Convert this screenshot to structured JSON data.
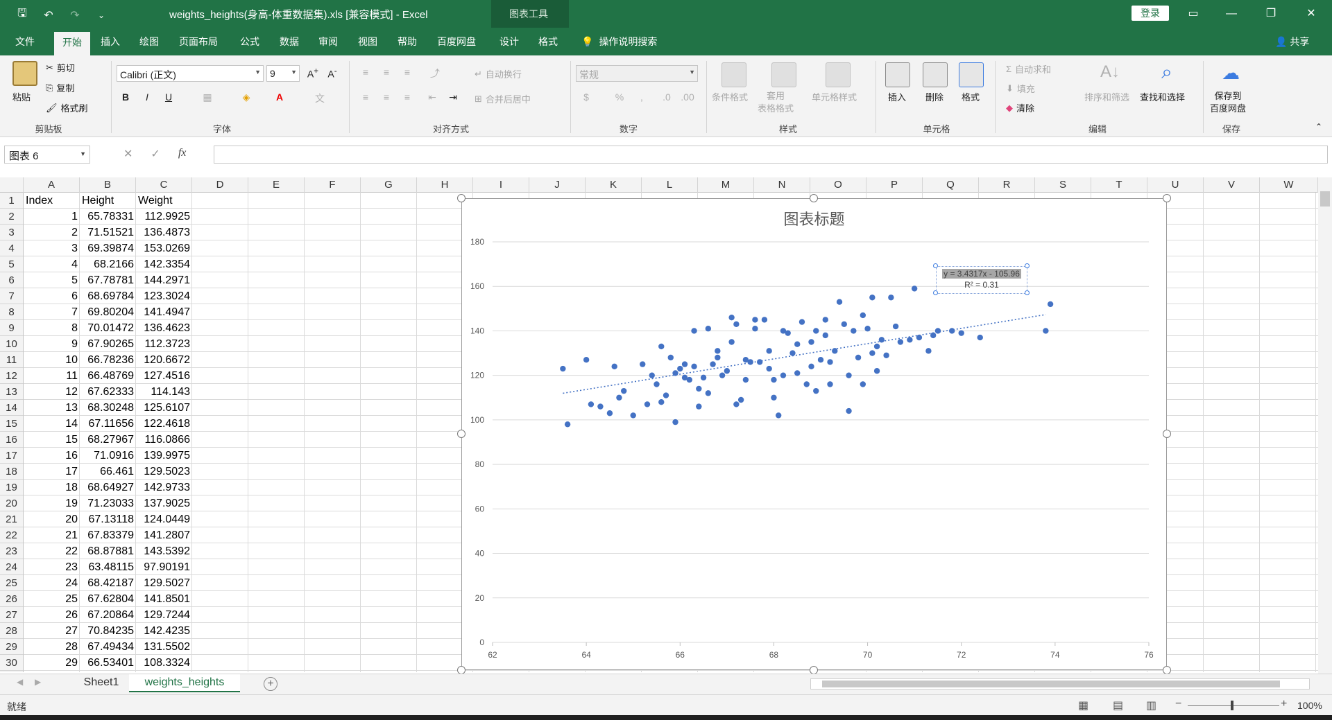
{
  "title_bar": {
    "doc_title": "weights_heights(身高-体重数据集).xls  [兼容模式]  -  Excel",
    "context_tab": "图表工具",
    "login": "登录"
  },
  "ribbon_tabs": [
    "文件",
    "开始",
    "插入",
    "绘图",
    "页面布局",
    "公式",
    "数据",
    "审阅",
    "视图",
    "帮助",
    "百度网盘",
    "设计",
    "格式"
  ],
  "active_tab": "开始",
  "tell_me": "操作说明搜索",
  "share": "共享",
  "ribbon": {
    "clipboard": {
      "paste": "粘贴",
      "cut": "剪切",
      "copy": "复制",
      "format_painter": "格式刷",
      "label": "剪贴板"
    },
    "font": {
      "family": "Calibri (正文)",
      "size": "9",
      "label": "字体"
    },
    "alignment": {
      "wrap": "自动换行",
      "merge": "合并后居中",
      "label": "对齐方式"
    },
    "number": {
      "format": "常规",
      "label": "数字"
    },
    "styles": {
      "conditional": "条件格式",
      "table": "套用\n表格格式",
      "cell_styles": "单元格样式",
      "label": "样式"
    },
    "cells": {
      "insert": "插入",
      "delete": "删除",
      "format": "格式",
      "label": "单元格"
    },
    "editing": {
      "autosum": "自动求和",
      "fill": "填充",
      "clear": "清除",
      "sort": "排序和筛选",
      "find": "查找和选择",
      "label": "编辑"
    },
    "save": {
      "save_baidu": "保存到\n百度网盘",
      "label": "保存"
    }
  },
  "formula_bar": {
    "name_box": "图表 6",
    "fx": "fx",
    "value": ""
  },
  "columns": [
    "A",
    "B",
    "C",
    "D",
    "E",
    "F",
    "G",
    "H",
    "I",
    "J",
    "K",
    "L",
    "M",
    "N",
    "O",
    "P",
    "Q",
    "R",
    "S",
    "T",
    "U",
    "V",
    "W"
  ],
  "rows": [
    1,
    2,
    3,
    4,
    5,
    6,
    7,
    8,
    9,
    10,
    11,
    12,
    13,
    14,
    15,
    16,
    17,
    18,
    19,
    20,
    21,
    22,
    23,
    24,
    25,
    26,
    27,
    28,
    29,
    30
  ],
  "table": {
    "headers": [
      "Index",
      "Height",
      "Weight"
    ],
    "rows": [
      [
        "1",
        "65.78331",
        "112.9925"
      ],
      [
        "2",
        "71.51521",
        "136.4873"
      ],
      [
        "3",
        "69.39874",
        "153.0269"
      ],
      [
        "4",
        "68.2166",
        "142.3354"
      ],
      [
        "5",
        "67.78781",
        "144.2971"
      ],
      [
        "6",
        "68.69784",
        "123.3024"
      ],
      [
        "7",
        "69.80204",
        "141.4947"
      ],
      [
        "8",
        "70.01472",
        "136.4623"
      ],
      [
        "9",
        "67.90265",
        "112.3723"
      ],
      [
        "10",
        "66.78236",
        "120.6672"
      ],
      [
        "11",
        "66.48769",
        "127.4516"
      ],
      [
        "12",
        "67.62333",
        "114.143"
      ],
      [
        "13",
        "68.30248",
        "125.6107"
      ],
      [
        "14",
        "67.11656",
        "122.4618"
      ],
      [
        "15",
        "68.27967",
        "116.0866"
      ],
      [
        "16",
        "71.0916",
        "139.9975"
      ],
      [
        "17",
        "66.461",
        "129.5023"
      ],
      [
        "18",
        "68.64927",
        "142.9733"
      ],
      [
        "19",
        "71.23033",
        "137.9025"
      ],
      [
        "20",
        "67.13118",
        "124.0449"
      ],
      [
        "21",
        "67.83379",
        "141.2807"
      ],
      [
        "22",
        "68.87881",
        "143.5392"
      ],
      [
        "23",
        "63.48115",
        "97.90191"
      ],
      [
        "24",
        "68.42187",
        "129.5027"
      ],
      [
        "25",
        "67.62804",
        "141.8501"
      ],
      [
        "26",
        "67.20864",
        "129.7244"
      ],
      [
        "27",
        "70.84235",
        "142.4235"
      ],
      [
        "28",
        "67.49434",
        "131.5502"
      ],
      [
        "29",
        "66.53401",
        "108.3324"
      ]
    ]
  },
  "chart_data": {
    "type": "scatter",
    "title": "图表标题",
    "xlim": [
      62,
      76
    ],
    "ylim": [
      0,
      180
    ],
    "x_ticks": [
      62,
      64,
      66,
      68,
      70,
      72,
      74,
      76
    ],
    "y_ticks": [
      0,
      20,
      40,
      60,
      80,
      100,
      120,
      140,
      160,
      180
    ],
    "grid": true,
    "marker_color": "#4472c4",
    "trendline": {
      "equation": "y = 3.4317x - 105.96",
      "r2_label": "R² = 0.31",
      "slope": 3.4317,
      "intercept": -105.96
    },
    "points": [
      [
        63.5,
        123
      ],
      [
        63.6,
        98
      ],
      [
        64,
        127
      ],
      [
        64.1,
        107
      ],
      [
        64.3,
        106
      ],
      [
        64.5,
        103
      ],
      [
        64.6,
        124
      ],
      [
        64.7,
        110
      ],
      [
        64.8,
        113
      ],
      [
        65,
        102
      ],
      [
        65.2,
        125
      ],
      [
        65.3,
        107
      ],
      [
        65.4,
        120
      ],
      [
        65.5,
        116
      ],
      [
        65.6,
        133
      ],
      [
        65.7,
        111
      ],
      [
        65.8,
        128
      ],
      [
        65.9,
        99
      ],
      [
        66,
        123
      ],
      [
        66.1,
        119
      ],
      [
        66.2,
        118
      ],
      [
        66.3,
        124
      ],
      [
        66.4,
        114
      ],
      [
        66.5,
        119
      ],
      [
        66.6,
        112
      ],
      [
        66.7,
        125
      ],
      [
        66.8,
        128
      ],
      [
        66.9,
        120
      ],
      [
        67,
        122
      ],
      [
        67.1,
        135
      ],
      [
        67.2,
        143
      ],
      [
        67.3,
        109
      ],
      [
        67.4,
        127
      ],
      [
        67.5,
        126
      ],
      [
        67.6,
        141
      ],
      [
        67.7,
        126
      ],
      [
        67.8,
        145
      ],
      [
        67.9,
        131
      ],
      [
        68,
        118
      ],
      [
        68.1,
        102
      ],
      [
        68.2,
        120
      ],
      [
        68.3,
        139
      ],
      [
        68.4,
        130
      ],
      [
        68.5,
        121
      ],
      [
        68.6,
        144
      ],
      [
        68.7,
        116
      ],
      [
        68.8,
        135
      ],
      [
        68.9,
        140
      ],
      [
        69,
        127
      ],
      [
        69.1,
        138
      ],
      [
        69.2,
        126
      ],
      [
        69.3,
        131
      ],
      [
        69.4,
        153
      ],
      [
        69.5,
        143
      ],
      [
        69.6,
        104
      ],
      [
        69.7,
        140
      ],
      [
        69.8,
        128
      ],
      [
        69.9,
        147
      ],
      [
        70,
        141
      ],
      [
        70.1,
        155
      ],
      [
        70.2,
        133
      ],
      [
        70.3,
        136
      ],
      [
        70.4,
        129
      ],
      [
        70.5,
        155
      ],
      [
        70.7,
        135
      ],
      [
        70.9,
        136
      ],
      [
        71,
        159
      ],
      [
        71.1,
        137
      ],
      [
        71.3,
        131
      ],
      [
        71.5,
        140
      ],
      [
        71.8,
        140
      ],
      [
        72,
        139
      ],
      [
        72.4,
        137
      ],
      [
        73.8,
        140
      ],
      [
        73.9,
        152
      ],
      [
        66.3,
        140
      ],
      [
        66.6,
        141
      ],
      [
        67.1,
        146
      ],
      [
        67.6,
        145
      ],
      [
        68.2,
        140
      ],
      [
        65.9,
        121
      ],
      [
        66.8,
        131
      ],
      [
        67.4,
        118
      ],
      [
        68.5,
        134
      ],
      [
        69.1,
        145
      ],
      [
        69.6,
        120
      ],
      [
        70.2,
        122
      ],
      [
        70.6,
        142
      ],
      [
        71.4,
        138
      ],
      [
        66.1,
        125
      ],
      [
        67.9,
        123
      ],
      [
        68.8,
        124
      ],
      [
        69.2,
        116
      ],
      [
        70.1,
        130
      ],
      [
        65.6,
        108
      ],
      [
        66.4,
        106
      ],
      [
        67.2,
        107
      ],
      [
        68,
        110
      ],
      [
        68.9,
        113
      ],
      [
        69.9,
        116
      ]
    ]
  },
  "sheet_tabs": [
    "Sheet1",
    "weights_heights"
  ],
  "active_sheet": "weights_heights",
  "status": {
    "ready": "就绪",
    "zoom": "100%"
  }
}
